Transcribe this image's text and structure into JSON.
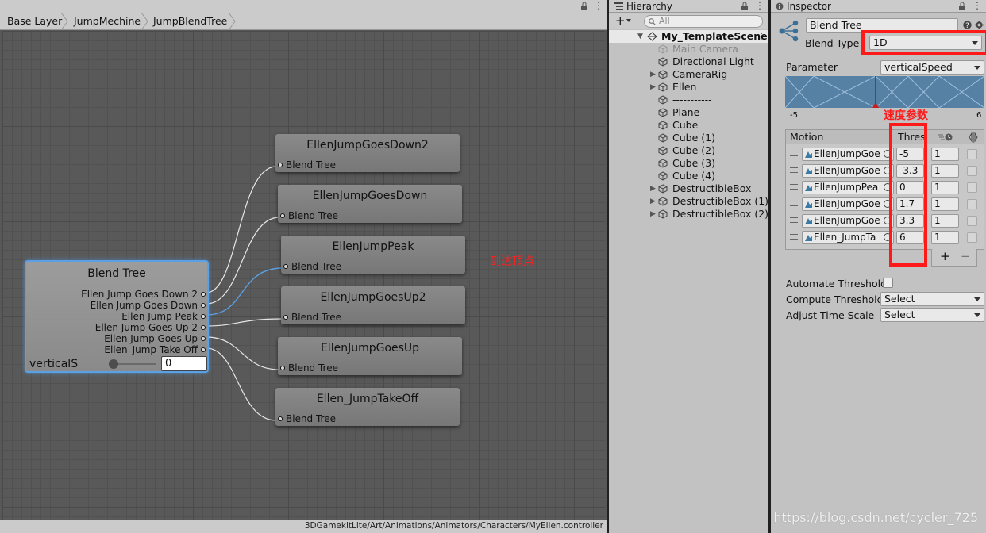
{
  "animator": {
    "breadcrumb": [
      "Base Layer",
      "JumpMechine",
      "JumpBlendTree"
    ],
    "status_path": "3DGamekitLite/Art/Animations/Animators/Characters/MyEllen.controller",
    "main_node": {
      "title": "Blend Tree",
      "outputs": [
        "Ellen Jump Goes Down 2",
        "Ellen Jump Goes Down",
        "Ellen Jump Peak",
        "Ellen Jump Goes Up 2",
        "Ellen Jump Goes Up",
        "Ellen_Jump Take Off"
      ],
      "parameter_label": "verticalS",
      "parameter_value": "0"
    },
    "child_nodes": [
      {
        "title": "EllenJumpGoesDown2",
        "sub": "Blend Tree"
      },
      {
        "title": "EllenJumpGoesDown",
        "sub": "Blend Tree"
      },
      {
        "title": "EllenJumpPeak",
        "sub": "Blend Tree"
      },
      {
        "title": "EllenJumpGoesUp2",
        "sub": "Blend Tree"
      },
      {
        "title": "EllenJumpGoesUp",
        "sub": "Blend Tree"
      },
      {
        "title": "Ellen_JumpTakeOff",
        "sub": "Blend Tree"
      }
    ],
    "annotation": "到达顶点"
  },
  "hierarchy": {
    "tab": "Hierarchy",
    "add": "+",
    "search_placeholder": "All",
    "scene": "My_TemplateScene",
    "items": [
      {
        "label": "Main Camera",
        "expandable": false,
        "dim": true
      },
      {
        "label": "Directional Light",
        "expandable": false,
        "dim": false
      },
      {
        "label": "CameraRig",
        "expandable": true,
        "dim": false
      },
      {
        "label": "Ellen",
        "expandable": true,
        "dim": false
      },
      {
        "label": "-----------",
        "expandable": false,
        "dim": false
      },
      {
        "label": "Plane",
        "expandable": false,
        "dim": false
      },
      {
        "label": "Cube",
        "expandable": false,
        "dim": false
      },
      {
        "label": "Cube (1)",
        "expandable": false,
        "dim": false
      },
      {
        "label": "Cube (2)",
        "expandable": false,
        "dim": false
      },
      {
        "label": "Cube (3)",
        "expandable": false,
        "dim": false
      },
      {
        "label": "Cube (4)",
        "expandable": false,
        "dim": false
      },
      {
        "label": "DestructibleBox",
        "expandable": true,
        "dim": false
      },
      {
        "label": "DestructibleBox (1)",
        "expandable": true,
        "dim": false
      },
      {
        "label": "DestructibleBox (2)",
        "expandable": true,
        "dim": false
      }
    ]
  },
  "inspector": {
    "tab": "Inspector",
    "name": "Blend Tree",
    "blend_type_label": "Blend Type",
    "blend_type_value": "1D",
    "parameter_label": "Parameter",
    "parameter_value": "verticalSpeed",
    "range_min": "-5",
    "range_max": "6",
    "annotation": "速度参数",
    "motion_header": "Motion",
    "threshold_header": "Thres",
    "motions": [
      {
        "clip": "EllenJumpGoe",
        "threshold": "-5",
        "speed": "1"
      },
      {
        "clip": "EllenJumpGoe",
        "threshold": "-3.3",
        "speed": "1"
      },
      {
        "clip": "EllenJumpPea",
        "threshold": "0",
        "speed": "1"
      },
      {
        "clip": "EllenJumpGoe",
        "threshold": "1.7",
        "speed": "1"
      },
      {
        "clip": "EllenJumpGoe",
        "threshold": "3.3",
        "speed": "1"
      },
      {
        "clip": "Ellen_JumpTa",
        "threshold": "6",
        "speed": "1"
      }
    ],
    "add_button": "+",
    "remove_button": "−",
    "automate_label": "Automate Thresholds",
    "compute_label": "Compute Thresholds",
    "compute_value": "Select",
    "adjust_label": "Adjust Time Scale",
    "adjust_value": "Select"
  },
  "watermark": "https://blog.csdn.net/cycler_725",
  "colors": {
    "accent_red": "#ff1a1a",
    "selection_blue": "#5aa0e6"
  }
}
